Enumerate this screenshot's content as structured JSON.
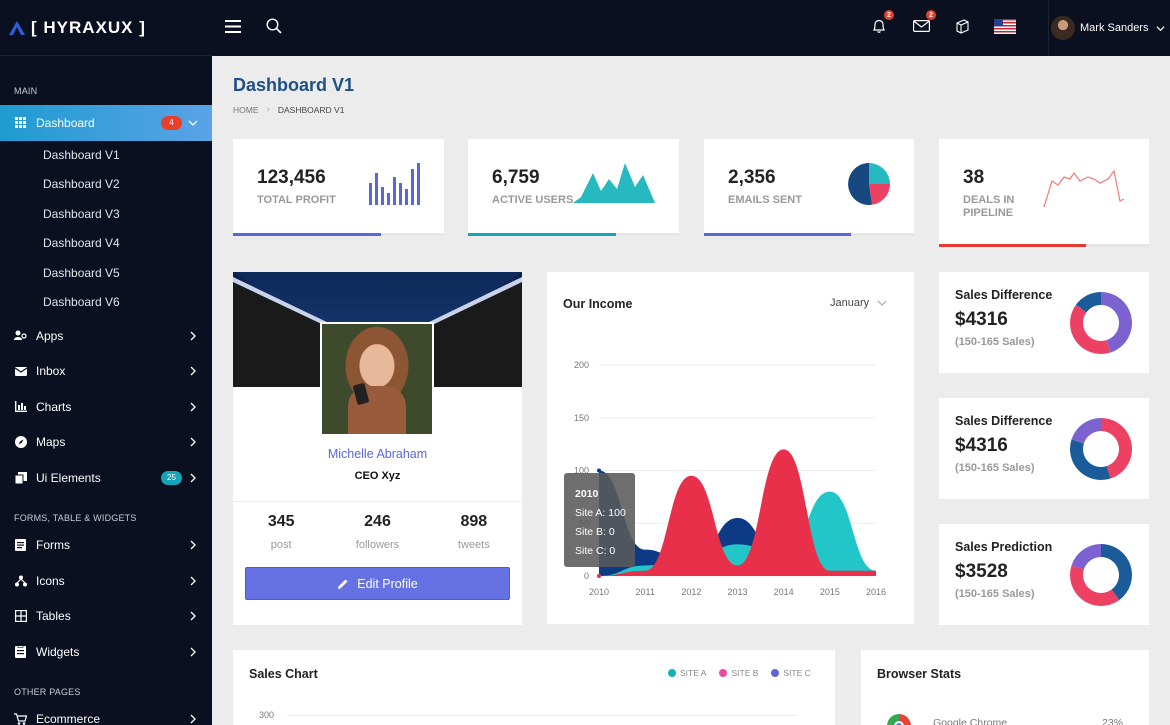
{
  "brand": {
    "name": "[ HYRAXUX ]"
  },
  "sidebar": {
    "section_main": "MAIN",
    "dashboard": {
      "label": "Dashboard",
      "badge": "4"
    },
    "submenu": [
      "Dashboard V1",
      "Dashboard V2",
      "Dashboard V3",
      "Dashboard V4",
      "Dashboard V5",
      "Dashboard V6"
    ],
    "apps": "Apps",
    "inbox": "Inbox",
    "charts": "Charts",
    "maps": "Maps",
    "ui_elements": {
      "label": "Ui Elements",
      "badge": "25"
    },
    "section_forms": "FORMS, TABLE & WIDGETS",
    "forms": "Forms",
    "icons": "Icons",
    "tables": "Tables",
    "widgets": "Widgets",
    "section_other": "OTHER PAGES",
    "ecommerce": "Ecommerce"
  },
  "topbar": {
    "user_name": "Mark Sanders",
    "notif_count_1": "2",
    "notif_count_2": "2"
  },
  "page": {
    "title": "Dashboard V1",
    "crumb_home": "HOME",
    "crumb_current": "DASHBOARD V1"
  },
  "stats": [
    {
      "value": "123,456",
      "label": "TOTAL PROFIT",
      "progress": 0.7,
      "color": "#5a67d8"
    },
    {
      "value": "6,759",
      "label": "ACTIVE USERS",
      "progress": 0.7,
      "color": "#12a7b8"
    },
    {
      "value": "2,356",
      "label": "EMAILS SENT",
      "progress": 0.7,
      "color": "#5a67d8"
    },
    {
      "value": "38",
      "label_1": "DEALS IN",
      "label_2": "PIPELINE",
      "progress": 0.7,
      "color": "#e53a33"
    }
  ],
  "profile": {
    "name": "Michelle Abraham",
    "role": "CEO Xyz",
    "posts": "345",
    "posts_label": "post",
    "followers": "246",
    "followers_label": "followers",
    "tweets": "898",
    "tweets_label": "tweets",
    "edit_label": "Edit Profile"
  },
  "income": {
    "title": "Our Income",
    "month": "January",
    "tooltip": {
      "year": "2010",
      "a": "Site A: 100",
      "b": "Site B: 0",
      "c": "Site C: 0"
    }
  },
  "chart_data": {
    "type": "area",
    "x": [
      "2010",
      "2011",
      "2012",
      "2013",
      "2014",
      "2015",
      "2016"
    ],
    "y_ticks": [
      "0",
      "50",
      "100",
      "150",
      "200"
    ],
    "ylim": [
      0,
      200
    ],
    "series": [
      {
        "color": "#0d3a85",
        "values": [
          100,
          25,
          10,
          55,
          10,
          20,
          5
        ]
      },
      {
        "color": "#22c6c8",
        "values": [
          0,
          10,
          15,
          30,
          20,
          80,
          5
        ]
      },
      {
        "color": "#e8304a",
        "values": [
          0,
          5,
          95,
          10,
          120,
          5,
          5
        ]
      }
    ],
    "grid": true
  },
  "side_cards": [
    {
      "title": "Sales Difference",
      "value": "$4316",
      "sub": "(150-165 Sales)",
      "donut": [
        {
          "v": 0.45,
          "c": "#7b62d0"
        },
        {
          "v": 0.4,
          "c": "#ec4163"
        },
        {
          "v": 0.15,
          "c": "#1a5b9a"
        }
      ]
    },
    {
      "title": "Sales Difference",
      "value": "$4316",
      "sub": "(150-165 Sales)",
      "donut": [
        {
          "v": 0.45,
          "c": "#ec4163"
        },
        {
          "v": 0.35,
          "c": "#1a5b9a"
        },
        {
          "v": 0.2,
          "c": "#7b62d0"
        }
      ]
    },
    {
      "title": "Sales Prediction",
      "value": "$3528",
      "sub": "(150-165 Sales)",
      "donut": [
        {
          "v": 0.4,
          "c": "#1a5b9a"
        },
        {
          "v": 0.4,
          "c": "#ec4163"
        },
        {
          "v": 0.2,
          "c": "#7b62d0"
        }
      ]
    }
  ],
  "sales_chart": {
    "title": "Sales Chart",
    "legend": [
      {
        "name": "SITE A",
        "color": "#15b1b8"
      },
      {
        "name": "SITE B",
        "color": "#ec4ba3"
      },
      {
        "name": "SITE C",
        "color": "#5f63d6"
      }
    ],
    "top_tick": "300"
  },
  "browser_stats": {
    "title": "Browser Stats",
    "first_item": "Google Chrome",
    "first_value": "23%"
  }
}
